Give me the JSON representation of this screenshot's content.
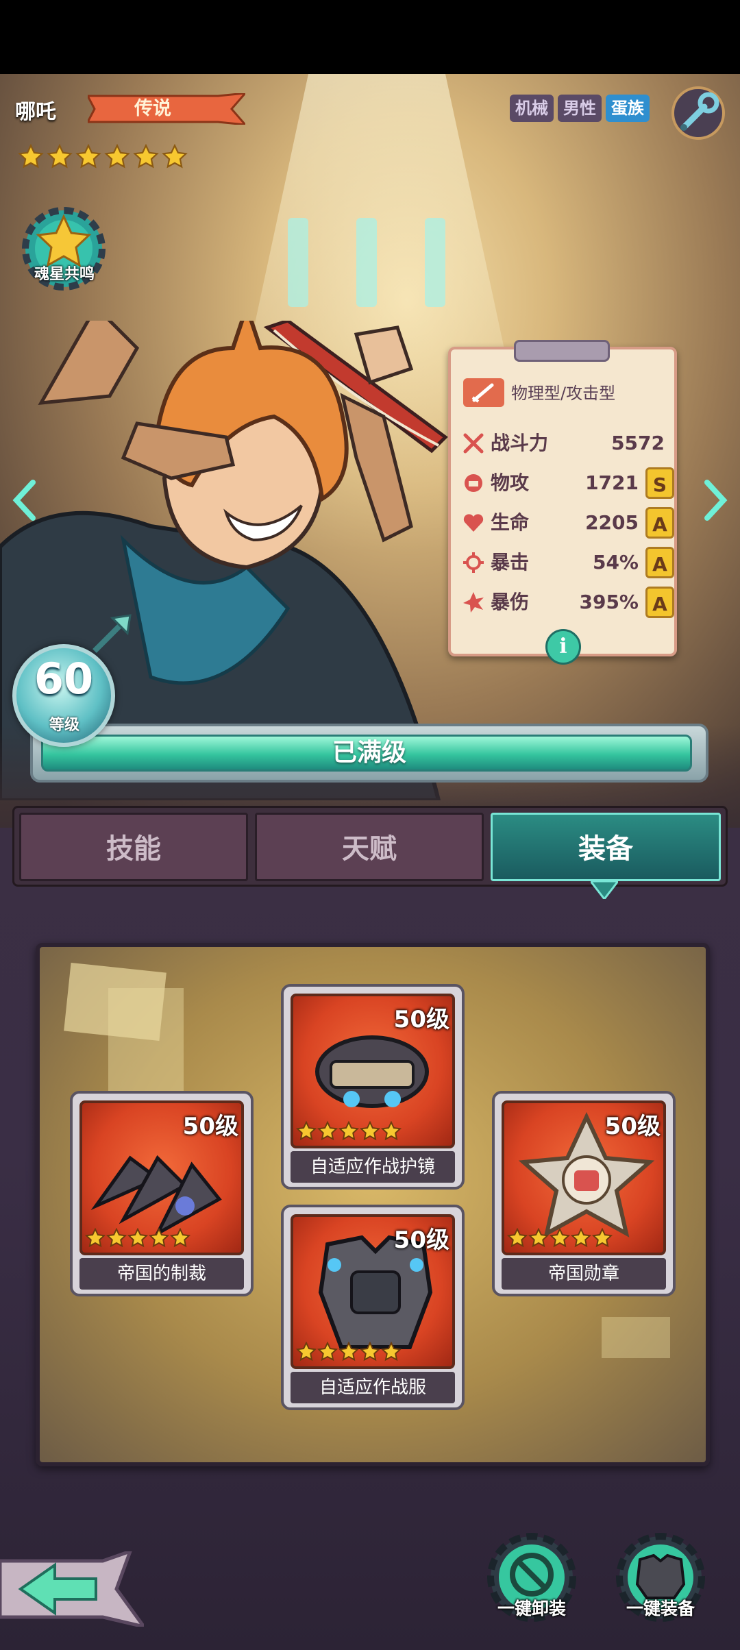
{
  "hero": {
    "name": "哪吒",
    "rarity": "传说",
    "star_count": 6,
    "tags": [
      "机械",
      "男性",
      "蛋族"
    ],
    "soul_resonance_label": "魂星共鸣"
  },
  "stats": {
    "type_label": "物理型/攻击型",
    "rows": [
      {
        "name": "战斗力",
        "value": "5572",
        "grade": ""
      },
      {
        "name": "物攻",
        "value": "1721",
        "grade": "S"
      },
      {
        "name": "生命",
        "value": "2205",
        "grade": "A"
      },
      {
        "name": "暴击",
        "value": "54%",
        "grade": "A"
      },
      {
        "name": "暴伤",
        "value": "395%",
        "grade": "A"
      }
    ]
  },
  "level": {
    "value": "60",
    "label": "等级",
    "bar_text": "已满级",
    "progress": 1.0
  },
  "tabs": [
    "技能",
    "天赋",
    "装备"
  ],
  "active_tab": "装备",
  "equipment": [
    {
      "slot": "weapon",
      "name": "帝国的制裁",
      "level": "50级",
      "stars": 5
    },
    {
      "slot": "goggles",
      "name": "自适应作战护镜",
      "level": "50级",
      "stars": 5
    },
    {
      "slot": "armor",
      "name": "自适应作战服",
      "level": "50级",
      "stars": 5
    },
    {
      "slot": "medal",
      "name": "帝国勋章",
      "level": "50级",
      "stars": 5
    }
  ],
  "actions": {
    "unequip_all": "一键卸装",
    "equip_all": "一键装备"
  },
  "colors": {
    "accent_teal": "#34c49e",
    "legend_orange": "#e8663f",
    "grade_gold": "#f3c52e",
    "item_red": "#d94423"
  }
}
